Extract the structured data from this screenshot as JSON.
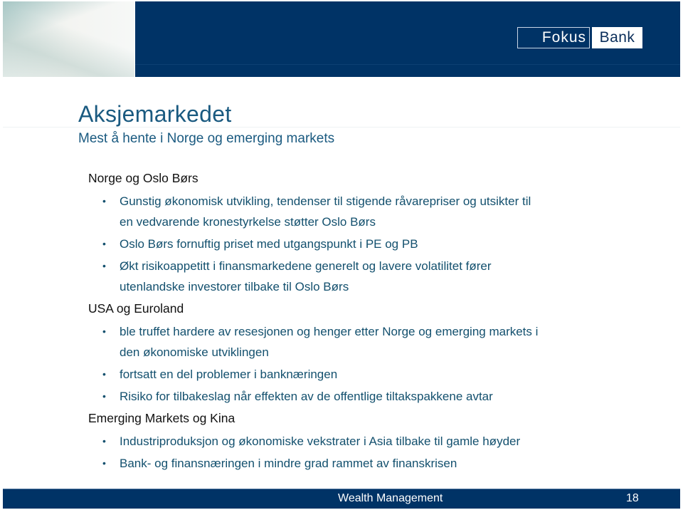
{
  "header": {
    "logo": {
      "part1": "Fokus",
      "part2": "Bank"
    },
    "colors": {
      "band": "#003366",
      "title": "#1a5a80",
      "body": "#13506e"
    }
  },
  "slide": {
    "title": "Aksjemarkedet",
    "subtitle": "Mest å hente i Norge og emerging markets"
  },
  "sections": [
    {
      "heading": "Norge og Oslo Børs",
      "bullets": [
        {
          "lines": [
            "Gunstig økonomisk utvikling, tendenser til stigende råvarepriser og utsikter til",
            "en vedvarende kronestyrkelse støtter Oslo Børs"
          ]
        },
        {
          "lines": [
            "Oslo Børs fornuftig priset med utgangspunkt i PE og PB"
          ]
        },
        {
          "lines": [
            "Økt risikoappetitt i finansmarkedene generelt og lavere volatilitet fører",
            "utenlandske investorer tilbake til Oslo Børs"
          ]
        }
      ]
    },
    {
      "heading": "USA og Euroland",
      "bullets": [
        {
          "lines": [
            "ble truffet hardere av resesjonen og henger etter Norge og emerging markets i",
            "den økonomiske utviklingen"
          ]
        },
        {
          "lines": [
            "fortsatt en del problemer i banknæringen"
          ]
        },
        {
          "lines": [
            "Risiko for tilbakeslag når effekten av de offentlige tiltakspakkene avtar"
          ]
        }
      ]
    },
    {
      "heading": "Emerging Markets og Kina",
      "bullets": [
        {
          "lines": [
            "Industriproduksjon og økonomiske vekstrater i Asia tilbake til gamle høyder"
          ]
        },
        {
          "lines": [
            "Bank- og finansnæringen i mindre grad rammet av finanskrisen"
          ]
        }
      ]
    }
  ],
  "bullet_glyph": "•",
  "footer": {
    "label": "Wealth Management",
    "page_number": "18"
  }
}
